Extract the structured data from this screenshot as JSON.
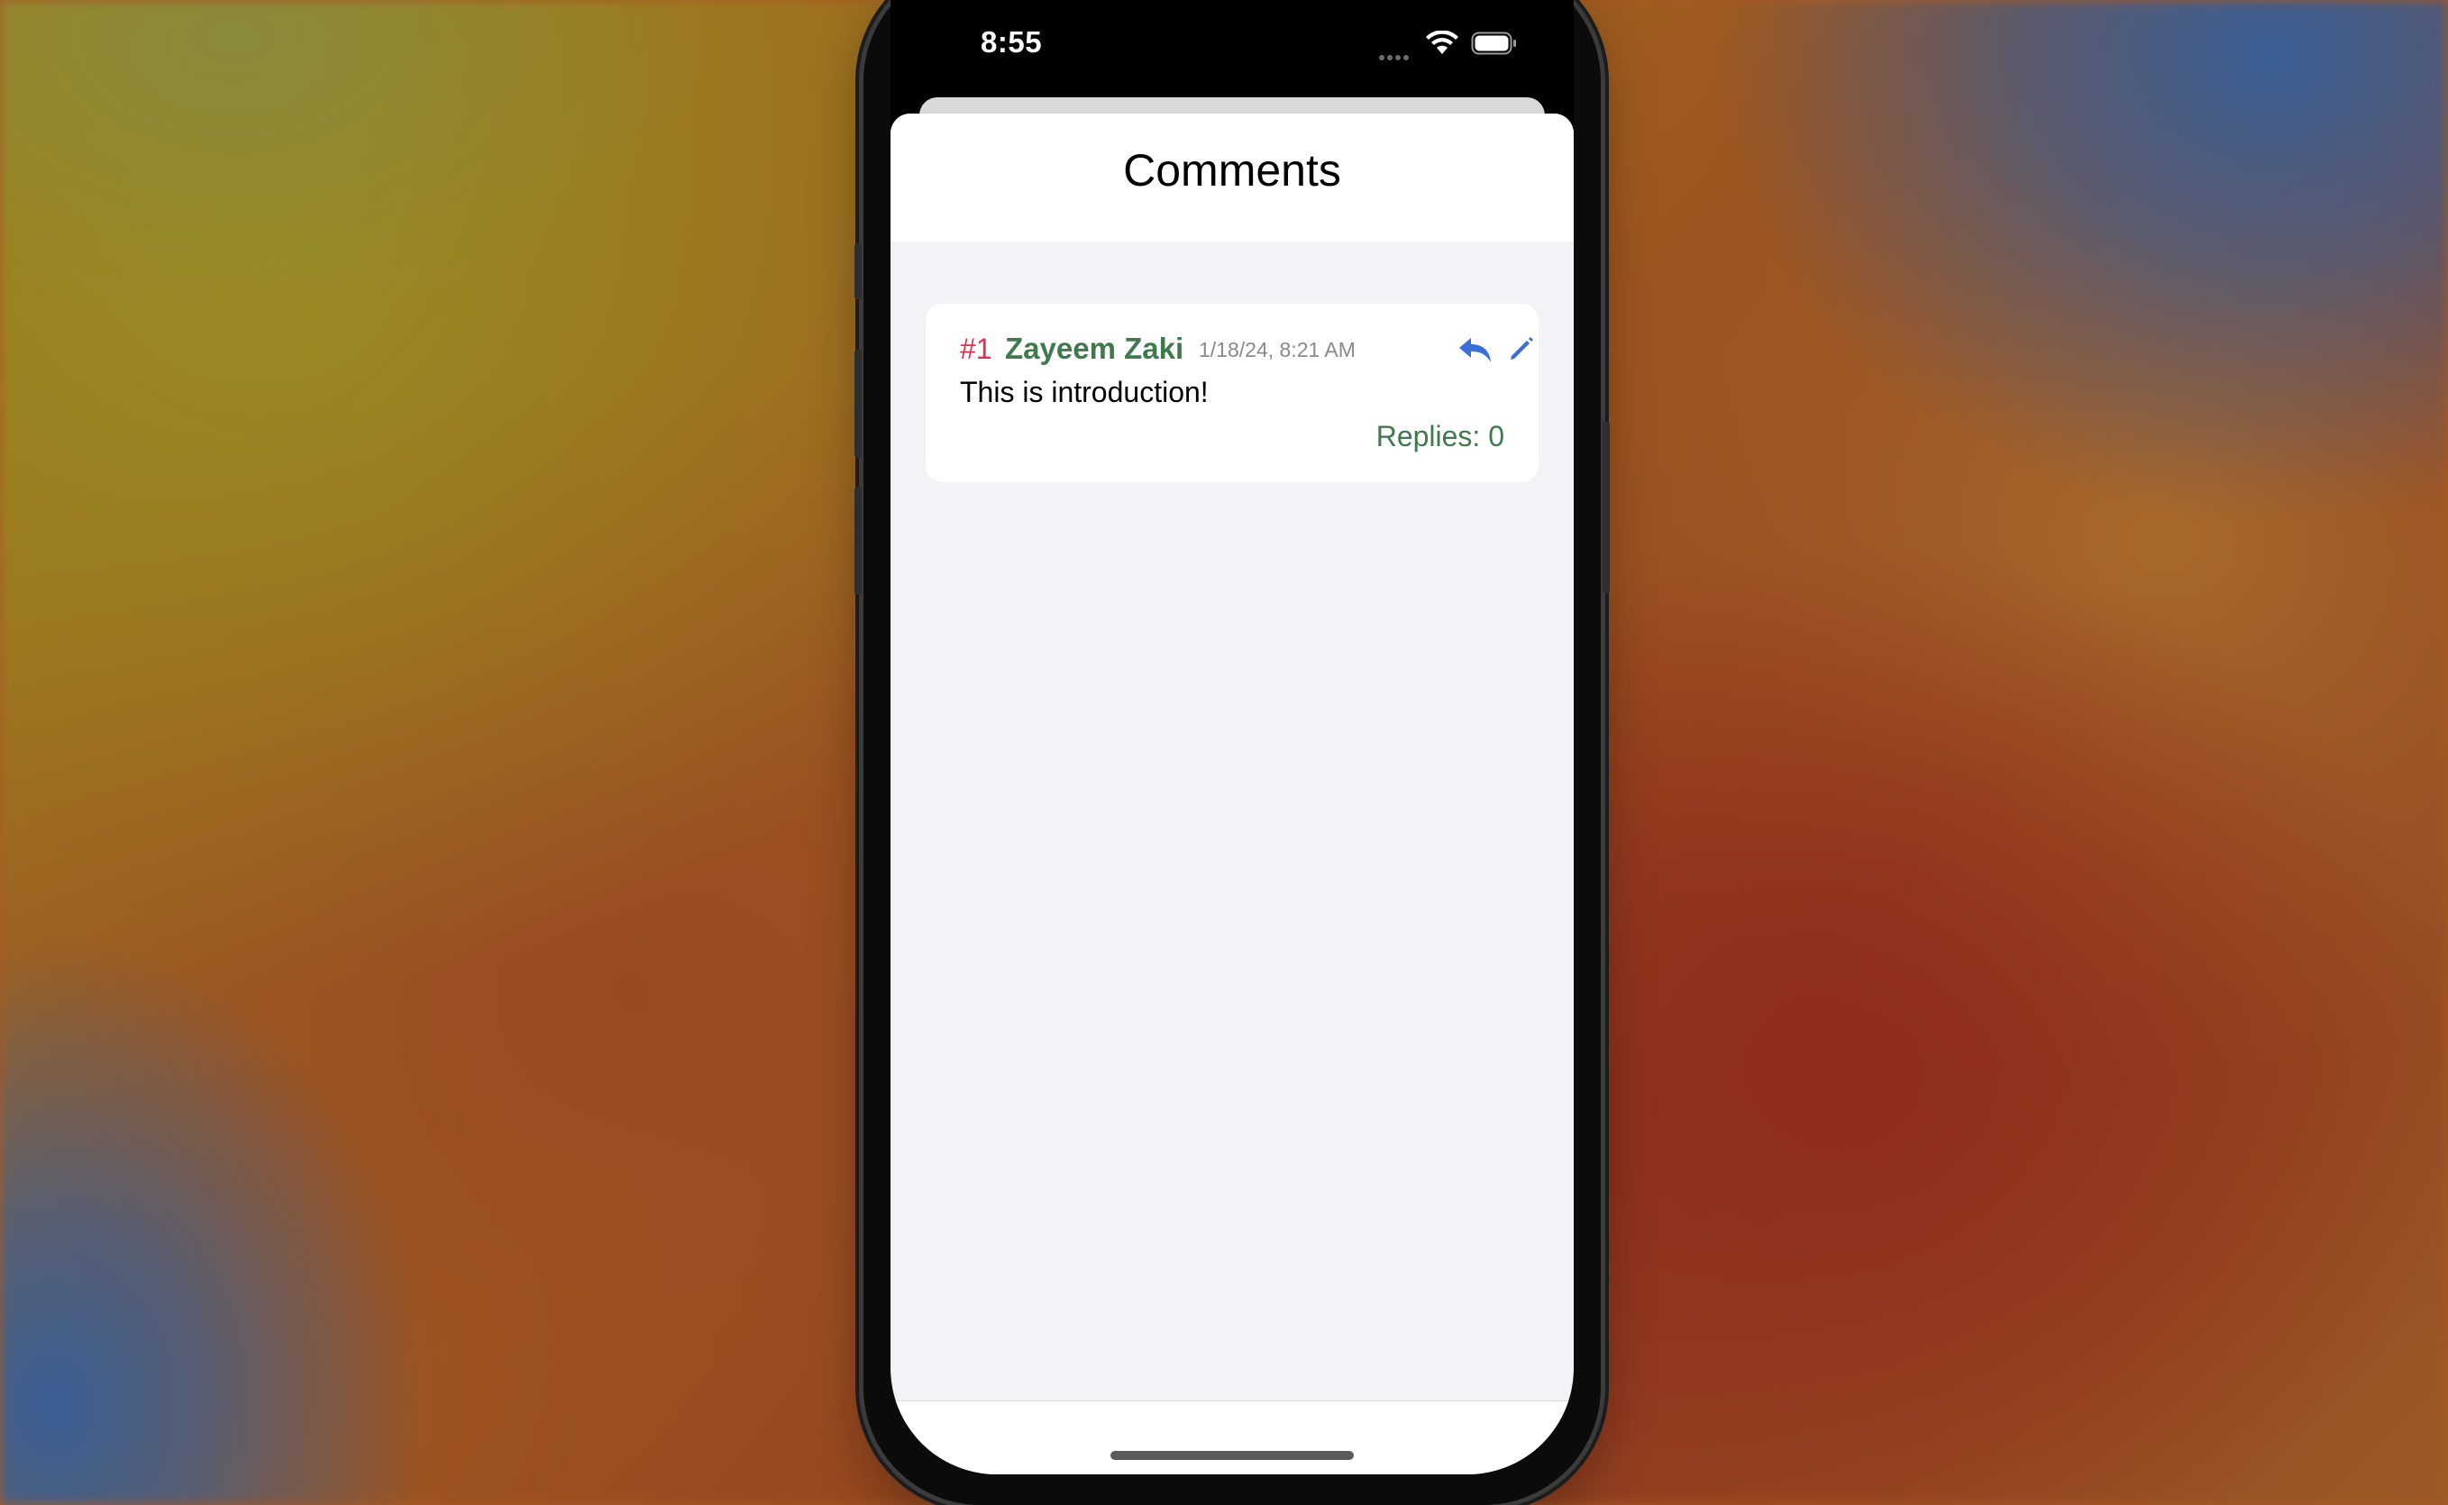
{
  "status_bar": {
    "time": "8:55",
    "wifi_icon": "wifi-icon",
    "battery_icon": "battery-icon",
    "signal_icon": "cellular-dots-icon"
  },
  "sheet": {
    "title": "Comments"
  },
  "comments": [
    {
      "number": "#1",
      "author": "Zayeem Zaki",
      "date": "1/18/24, 8:21 AM",
      "text": "This is introduction!",
      "replies": "Replies: 0",
      "reply_icon": "reply-arrow-icon",
      "edit_icon": "pencil-icon"
    }
  ],
  "colors": {
    "number": "#e0314b",
    "author": "#3f7a4c",
    "accent_icon": "#3b6fd8",
    "sheet_background": "#f2f2f7"
  }
}
